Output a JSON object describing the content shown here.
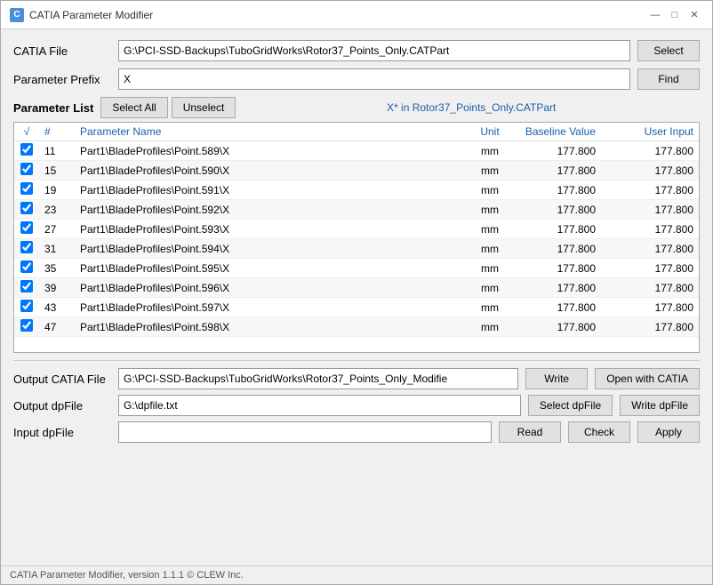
{
  "window": {
    "title": "CATIA Parameter Modifier",
    "icon": "C",
    "controls": {
      "minimize": "—",
      "maximize": "□",
      "close": "✕"
    }
  },
  "catia_file": {
    "label": "CATIA File",
    "value": "G:\\PCI-SSD-Backups\\TuboGridWorks\\Rotor37_Points_Only.CATPart",
    "select_btn": "Select"
  },
  "parameter_prefix": {
    "label": "Parameter Prefix",
    "value": "X",
    "find_btn": "Find"
  },
  "parameter_list": {
    "title": "Parameter List",
    "filter_text": "X*  in  Rotor37_Points_Only.CATPart",
    "select_all_btn": "Select All",
    "unselect_btn": "Unselect",
    "columns": [
      {
        "label": "√",
        "key": "checked"
      },
      {
        "label": "#",
        "key": "num"
      },
      {
        "label": "Parameter Name",
        "key": "name"
      },
      {
        "label": "Unit",
        "key": "unit"
      },
      {
        "label": "Baseline Value",
        "key": "baseline"
      },
      {
        "label": "User Input",
        "key": "userinput"
      }
    ],
    "rows": [
      {
        "checked": true,
        "num": 11,
        "name": "Part1\\BladeProfiles\\Point.589\\X",
        "unit": "mm",
        "baseline": "177.800",
        "userinput": "177.800"
      },
      {
        "checked": true,
        "num": 15,
        "name": "Part1\\BladeProfiles\\Point.590\\X",
        "unit": "mm",
        "baseline": "177.800",
        "userinput": "177.800"
      },
      {
        "checked": true,
        "num": 19,
        "name": "Part1\\BladeProfiles\\Point.591\\X",
        "unit": "mm",
        "baseline": "177.800",
        "userinput": "177.800"
      },
      {
        "checked": true,
        "num": 23,
        "name": "Part1\\BladeProfiles\\Point.592\\X",
        "unit": "mm",
        "baseline": "177.800",
        "userinput": "177.800"
      },
      {
        "checked": true,
        "num": 27,
        "name": "Part1\\BladeProfiles\\Point.593\\X",
        "unit": "mm",
        "baseline": "177.800",
        "userinput": "177.800"
      },
      {
        "checked": true,
        "num": 31,
        "name": "Part1\\BladeProfiles\\Point.594\\X",
        "unit": "mm",
        "baseline": "177.800",
        "userinput": "177.800"
      },
      {
        "checked": true,
        "num": 35,
        "name": "Part1\\BladeProfiles\\Point.595\\X",
        "unit": "mm",
        "baseline": "177.800",
        "userinput": "177.800"
      },
      {
        "checked": true,
        "num": 39,
        "name": "Part1\\BladeProfiles\\Point.596\\X",
        "unit": "mm",
        "baseline": "177.800",
        "userinput": "177.800"
      },
      {
        "checked": true,
        "num": 43,
        "name": "Part1\\BladeProfiles\\Point.597\\X",
        "unit": "mm",
        "baseline": "177.800",
        "userinput": "177.800"
      },
      {
        "checked": true,
        "num": 47,
        "name": "Part1\\BladeProfiles\\Point.598\\X",
        "unit": "mm",
        "baseline": "177.800",
        "userinput": "177.800"
      }
    ]
  },
  "output_catia": {
    "label": "Output CATIA File",
    "value": "G:\\PCI-SSD-Backups\\TuboGridWorks\\Rotor37_Points_Only_Modifie",
    "write_btn": "Write",
    "open_btn": "Open with CATIA"
  },
  "output_dp": {
    "label": "Output dpFile",
    "value": "G:\\dpfile.txt",
    "select_btn": "Select dpFile",
    "write_btn": "Write dpFile"
  },
  "input_dp": {
    "label": "Input dpFile",
    "value": "",
    "placeholder": "",
    "read_btn": "Read",
    "check_btn": "Check",
    "apply_btn": "Apply"
  },
  "status_bar": {
    "text": "CATIA Parameter Modifier, version 1.1.1 © CLEW Inc."
  }
}
